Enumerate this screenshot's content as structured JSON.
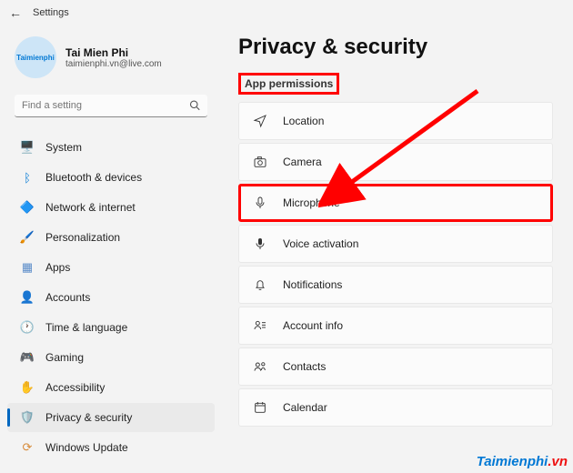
{
  "titlebar": {
    "label": "Settings"
  },
  "profile": {
    "name": "Tai Mien Phi",
    "email": "taimienphi.vn@live.com",
    "avatar_text": "Taimienphi"
  },
  "search": {
    "placeholder": "Find a setting"
  },
  "sidebar": {
    "items": [
      {
        "icon": "🖥️",
        "label": "System",
        "name": "system"
      },
      {
        "icon": "ᛒ",
        "label": "Bluetooth & devices",
        "name": "bluetooth",
        "color": "#0078d4"
      },
      {
        "icon": "🔷",
        "label": "Network & internet",
        "name": "network",
        "color": "#00b7c3"
      },
      {
        "icon": "🖌️",
        "label": "Personalization",
        "name": "personalization",
        "color": "#c97b3a"
      },
      {
        "icon": "▦",
        "label": "Apps",
        "name": "apps",
        "color": "#5b8cc9"
      },
      {
        "icon": "👤",
        "label": "Accounts",
        "name": "accounts",
        "color": "#6b8aa3"
      },
      {
        "icon": "🕐",
        "label": "Time & language",
        "name": "time-language",
        "color": "#4a7a8a"
      },
      {
        "icon": "🎮",
        "label": "Gaming",
        "name": "gaming",
        "color": "#555"
      },
      {
        "icon": "✋",
        "label": "Accessibility",
        "name": "accessibility",
        "color": "#4a6da8"
      },
      {
        "icon": "🛡️",
        "label": "Privacy & security",
        "name": "privacy-security",
        "color": "#3a6da8",
        "active": true
      },
      {
        "icon": "⟳",
        "label": "Windows Update",
        "name": "windows-update",
        "color": "#d78b3a"
      }
    ]
  },
  "main": {
    "title": "Privacy & security",
    "section_label": "App permissions",
    "permissions": [
      {
        "icon": "location",
        "label": "Location",
        "name": "location"
      },
      {
        "icon": "camera",
        "label": "Camera",
        "name": "camera"
      },
      {
        "icon": "mic",
        "label": "Microphone",
        "name": "microphone",
        "highlight": true
      },
      {
        "icon": "voice",
        "label": "Voice activation",
        "name": "voice-activation"
      },
      {
        "icon": "bell",
        "label": "Notifications",
        "name": "notifications"
      },
      {
        "icon": "account",
        "label": "Account info",
        "name": "account-info"
      },
      {
        "icon": "contacts",
        "label": "Contacts",
        "name": "contacts"
      },
      {
        "icon": "calendar",
        "label": "Calendar",
        "name": "calendar"
      }
    ]
  },
  "watermark": {
    "brand": "Taimienphi",
    "tld": ".vn"
  }
}
